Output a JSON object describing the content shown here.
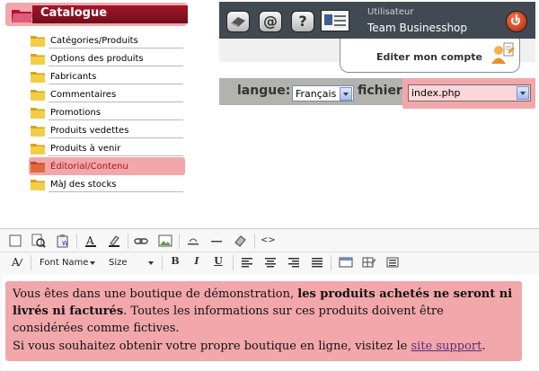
{
  "catalogue": {
    "title": "Catalogue",
    "items": [
      {
        "label": "Catégories/Produits"
      },
      {
        "label": "Options des produits"
      },
      {
        "label": "Fabricants"
      },
      {
        "label": "Commentaires"
      },
      {
        "label": "Promotions"
      },
      {
        "label": "Produits vedettes"
      },
      {
        "label": "Produits à venir"
      },
      {
        "label": "Éditorial/Contenu"
      },
      {
        "label": "MàJ des stocks"
      }
    ]
  },
  "userbar": {
    "user_label": "Utilisateur",
    "user_name": "Team Businesshop",
    "buttons": {
      "at": "@",
      "help": "?"
    },
    "account_label": "Editer mon compte"
  },
  "langbar": {
    "langue_label": "langue:",
    "langue_value": "Français",
    "fichier_label": "fichier:",
    "fichier_value": "index.php"
  },
  "editor": {
    "font_name": "Font Name",
    "size": "Size",
    "bold": "B",
    "italic": "I",
    "underline": "U",
    "source": "<>",
    "para1_text1": "Vous êtes dans une boutique de démonstration, ",
    "para1_bold": "les produits achetés ne seront ni livrés ni facturés",
    "para1_text2": ". Toutes les informations sur ces produits doivent être considérées comme fictives.",
    "para2_text1": "Si vous souhaitez obtenir votre propre boutique en ligne, visitez le ",
    "para2_link": "site support",
    "para2_text2": "."
  },
  "colors": {
    "highlight": "#f2a7ab",
    "catalogue_bar": "#8e1424",
    "userbar_bg": "#414a52",
    "langbar_bg": "#b3b3ae"
  }
}
